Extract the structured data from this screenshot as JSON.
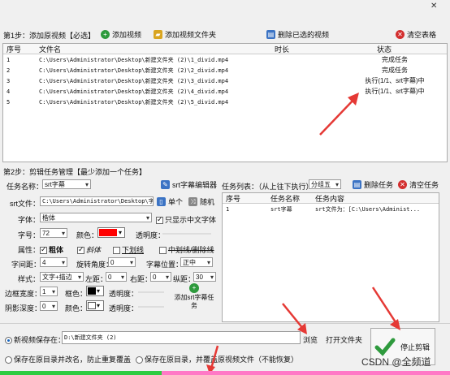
{
  "window": {
    "close_glyph": "✕"
  },
  "step1": {
    "title": "第1步：添加原视频【必选】",
    "add_video": "添加视频",
    "add_folder": "添加视频文件夹",
    "delete_selected": "删除已选的视频",
    "clear_table": "清空表格",
    "columns": [
      "序号",
      "文件名",
      "时长",
      "状态"
    ],
    "rows": [
      {
        "no": "1",
        "file": "C:\\Users\\Administrator\\Desktop\\新建文件夹 (2)\\1_divid.mp4",
        "duration": "",
        "status": "完成任务"
      },
      {
        "no": "2",
        "file": "C:\\Users\\Administrator\\Desktop\\新建文件夹 (2)\\2_divid.mp4",
        "duration": "",
        "status": "完成任务"
      },
      {
        "no": "3",
        "file": "C:\\Users\\Administrator\\Desktop\\新建文件夹 (2)\\3_divid.mp4",
        "duration": "",
        "status": "执行(1/1、srt字幕)中"
      },
      {
        "no": "4",
        "file": "C:\\Users\\Administrator\\Desktop\\新建文件夹 (2)\\4_divid.mp4",
        "duration": "",
        "status": "执行(1/1、srt字幕)中"
      },
      {
        "no": "5",
        "file": "C:\\Users\\Administrator\\Desktop\\新建文件夹 (2)\\5_divid.mp4",
        "duration": "",
        "status": ""
      }
    ]
  },
  "step2": {
    "title": "第2步：剪辑任务管理【最少添加一个任务】",
    "task_name_label": "任务名称：",
    "task_name_value": "srt字幕",
    "srt_editor": "srt字幕编辑器",
    "srt_file_label": "srt文件：",
    "srt_file_value": "C:\\Users\\Administrator\\Desktop\\字幕",
    "single": "单个",
    "random": "随机",
    "font_label": "字体：",
    "font_value": "楷体",
    "only_chinese": "只显示中文字体",
    "size_label": "字号：",
    "size_value": "72",
    "color_label": "颜色：",
    "color_value": "#ff0000",
    "opacity_label": "透明度：",
    "attr_label": "属性：",
    "bold": "粗体",
    "italic": "斜体",
    "underline": "下划线",
    "strikethrough": "中划线/删除线",
    "spacing_label": "字间距：",
    "spacing_value": "4",
    "rotate_label": "旋转角度：",
    "rotate_value": "0",
    "position_label": "字幕位置：",
    "position_value": "正中",
    "style_label": "样式：",
    "style_value": "文字+描边",
    "left_label": "左距：",
    "left_value": "0",
    "right_label": "右距：",
    "right_value": "0",
    "vert_label": "纵距：",
    "vert_value": "30",
    "border_label": "边框宽度：",
    "border_value": "1",
    "border_color_label": "框色：",
    "border_color": "#000000",
    "border_opacity_label": "透明度：",
    "shadow_label": "阴影深度：",
    "shadow_value": "0",
    "shadow_color_label": "颜色：",
    "shadow_color": "#ffffff",
    "shadow_opacity_label": "透明度：",
    "add_task": "添加srt字幕任务",
    "task_list_label": "任务列表：（从上往下执行）",
    "group_value": "分组五",
    "delete_task": "删除任务",
    "clear_tasks": "清空任务",
    "task_columns": [
      "序号",
      "任务名称",
      "任务内容"
    ],
    "tasks": [
      {
        "no": "1",
        "name": "srt字幕",
        "content": "srt文件为：[C:\\Users\\Administ..."
      }
    ]
  },
  "output": {
    "new_save_label": "新视频保存在：",
    "save_path": "D:\\新建文件夹 (2)",
    "browse": "浏览",
    "open_folder": "打开文件夹",
    "save_original": "保存在原目录并改名，防止重复覆盖",
    "save_overwrite": "保存在原目录，并覆盖原视频文件（不能恢复）",
    "stop": "停止剪辑"
  },
  "watermark": "CSDN @全频道",
  "progress": {
    "fraction": 0.36
  }
}
